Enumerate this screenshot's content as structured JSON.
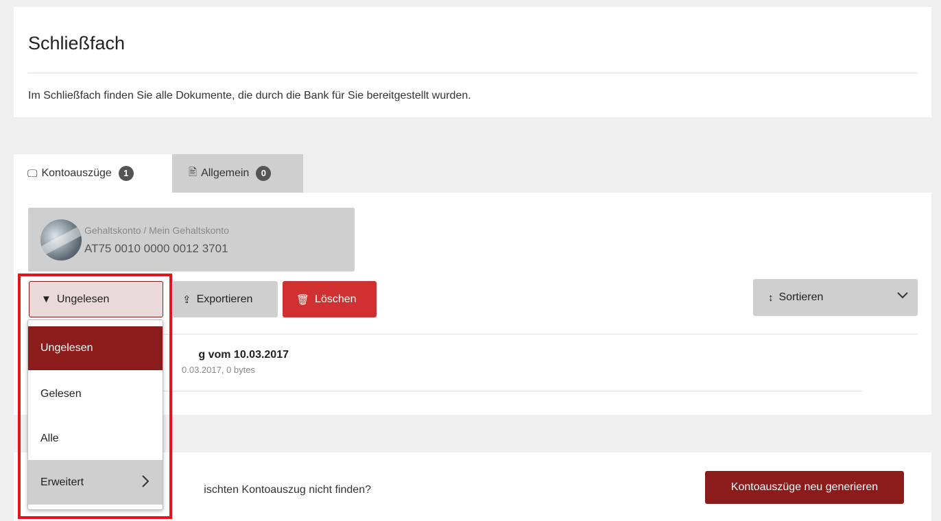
{
  "header": {
    "title": "Schließfach",
    "description": "Im Schließfach finden Sie alle Dokumente, die durch die Bank für Sie bereitgestellt wurden."
  },
  "tabs": [
    {
      "label": "Kontoauszüge",
      "count": "1",
      "icon": "statement-icon",
      "active": true
    },
    {
      "label": "Allgemein",
      "count": "0",
      "icon": "document-icon",
      "active": false
    }
  ],
  "account": {
    "type_name": "Gehaltskonto / Mein Gehaltskonto",
    "iban": "AT75 0010 0000 0012 3701"
  },
  "toolbar": {
    "filter_label": "Ungelesen",
    "export_label": "Exportieren",
    "delete_label": "Löschen",
    "sort_label": "Sortieren"
  },
  "documents": [
    {
      "title": "g vom 10.03.2017",
      "meta": "0.03.2017, 0 bytes"
    }
  ],
  "filter_menu": {
    "items": [
      "Ungelesen",
      "Gelesen",
      "Alle"
    ],
    "selected": "Ungelesen",
    "advanced_label": "Erweitert"
  },
  "footer": {
    "help_text": "ischten Kontoauszug nicht finden?",
    "regenerate_label": "Kontoauszüge neu generieren"
  },
  "colors": {
    "brand": "#8c1c1c",
    "danger": "#d0302f",
    "highlight": "#e3141b"
  }
}
